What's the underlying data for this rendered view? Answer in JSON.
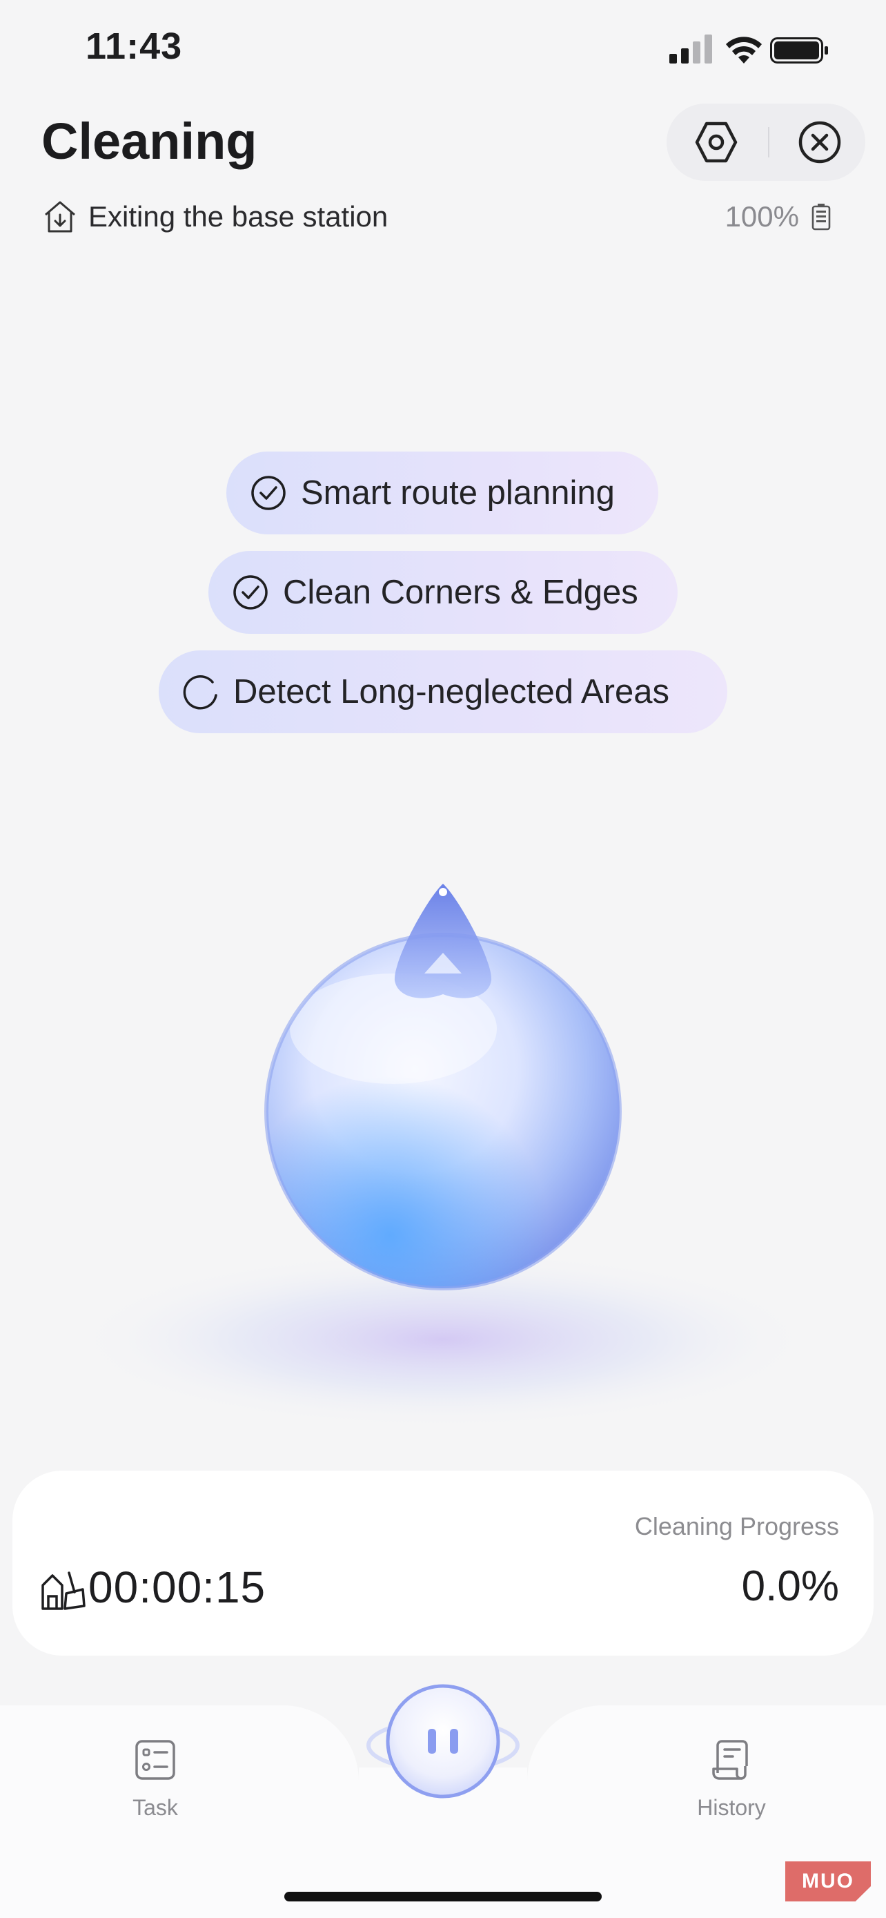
{
  "status_bar": {
    "time": "11:43",
    "icons": [
      "cellular-signal-icon",
      "wifi-icon",
      "battery-icon"
    ]
  },
  "header": {
    "title": "Cleaning",
    "actions": [
      "settings-hexagon-icon",
      "close-circle-icon"
    ]
  },
  "status": {
    "text": "Exiting the base station",
    "icon": "base-station-exit-icon",
    "battery_percent": "100%"
  },
  "features": [
    {
      "label": "Smart route planning",
      "state": "done"
    },
    {
      "label": "Clean Corners & Edges",
      "state": "done"
    },
    {
      "label": "Detect Long-neglected Areas",
      "state": "in-progress"
    }
  ],
  "progress_card": {
    "elapsed_time": "00:00:15",
    "progress_label": "Cleaning Progress",
    "progress_value": "0.0%"
  },
  "bottom_nav": {
    "task_label": "Task",
    "history_label": "History",
    "center_action": "pause"
  },
  "watermark": "MUO",
  "colors": {
    "background": "#f5f5f6",
    "pill_start": "#dbe0fb",
    "pill_end": "#ede6fb",
    "accent_blue": "#8a9cf0",
    "watermark": "#d9534f"
  }
}
